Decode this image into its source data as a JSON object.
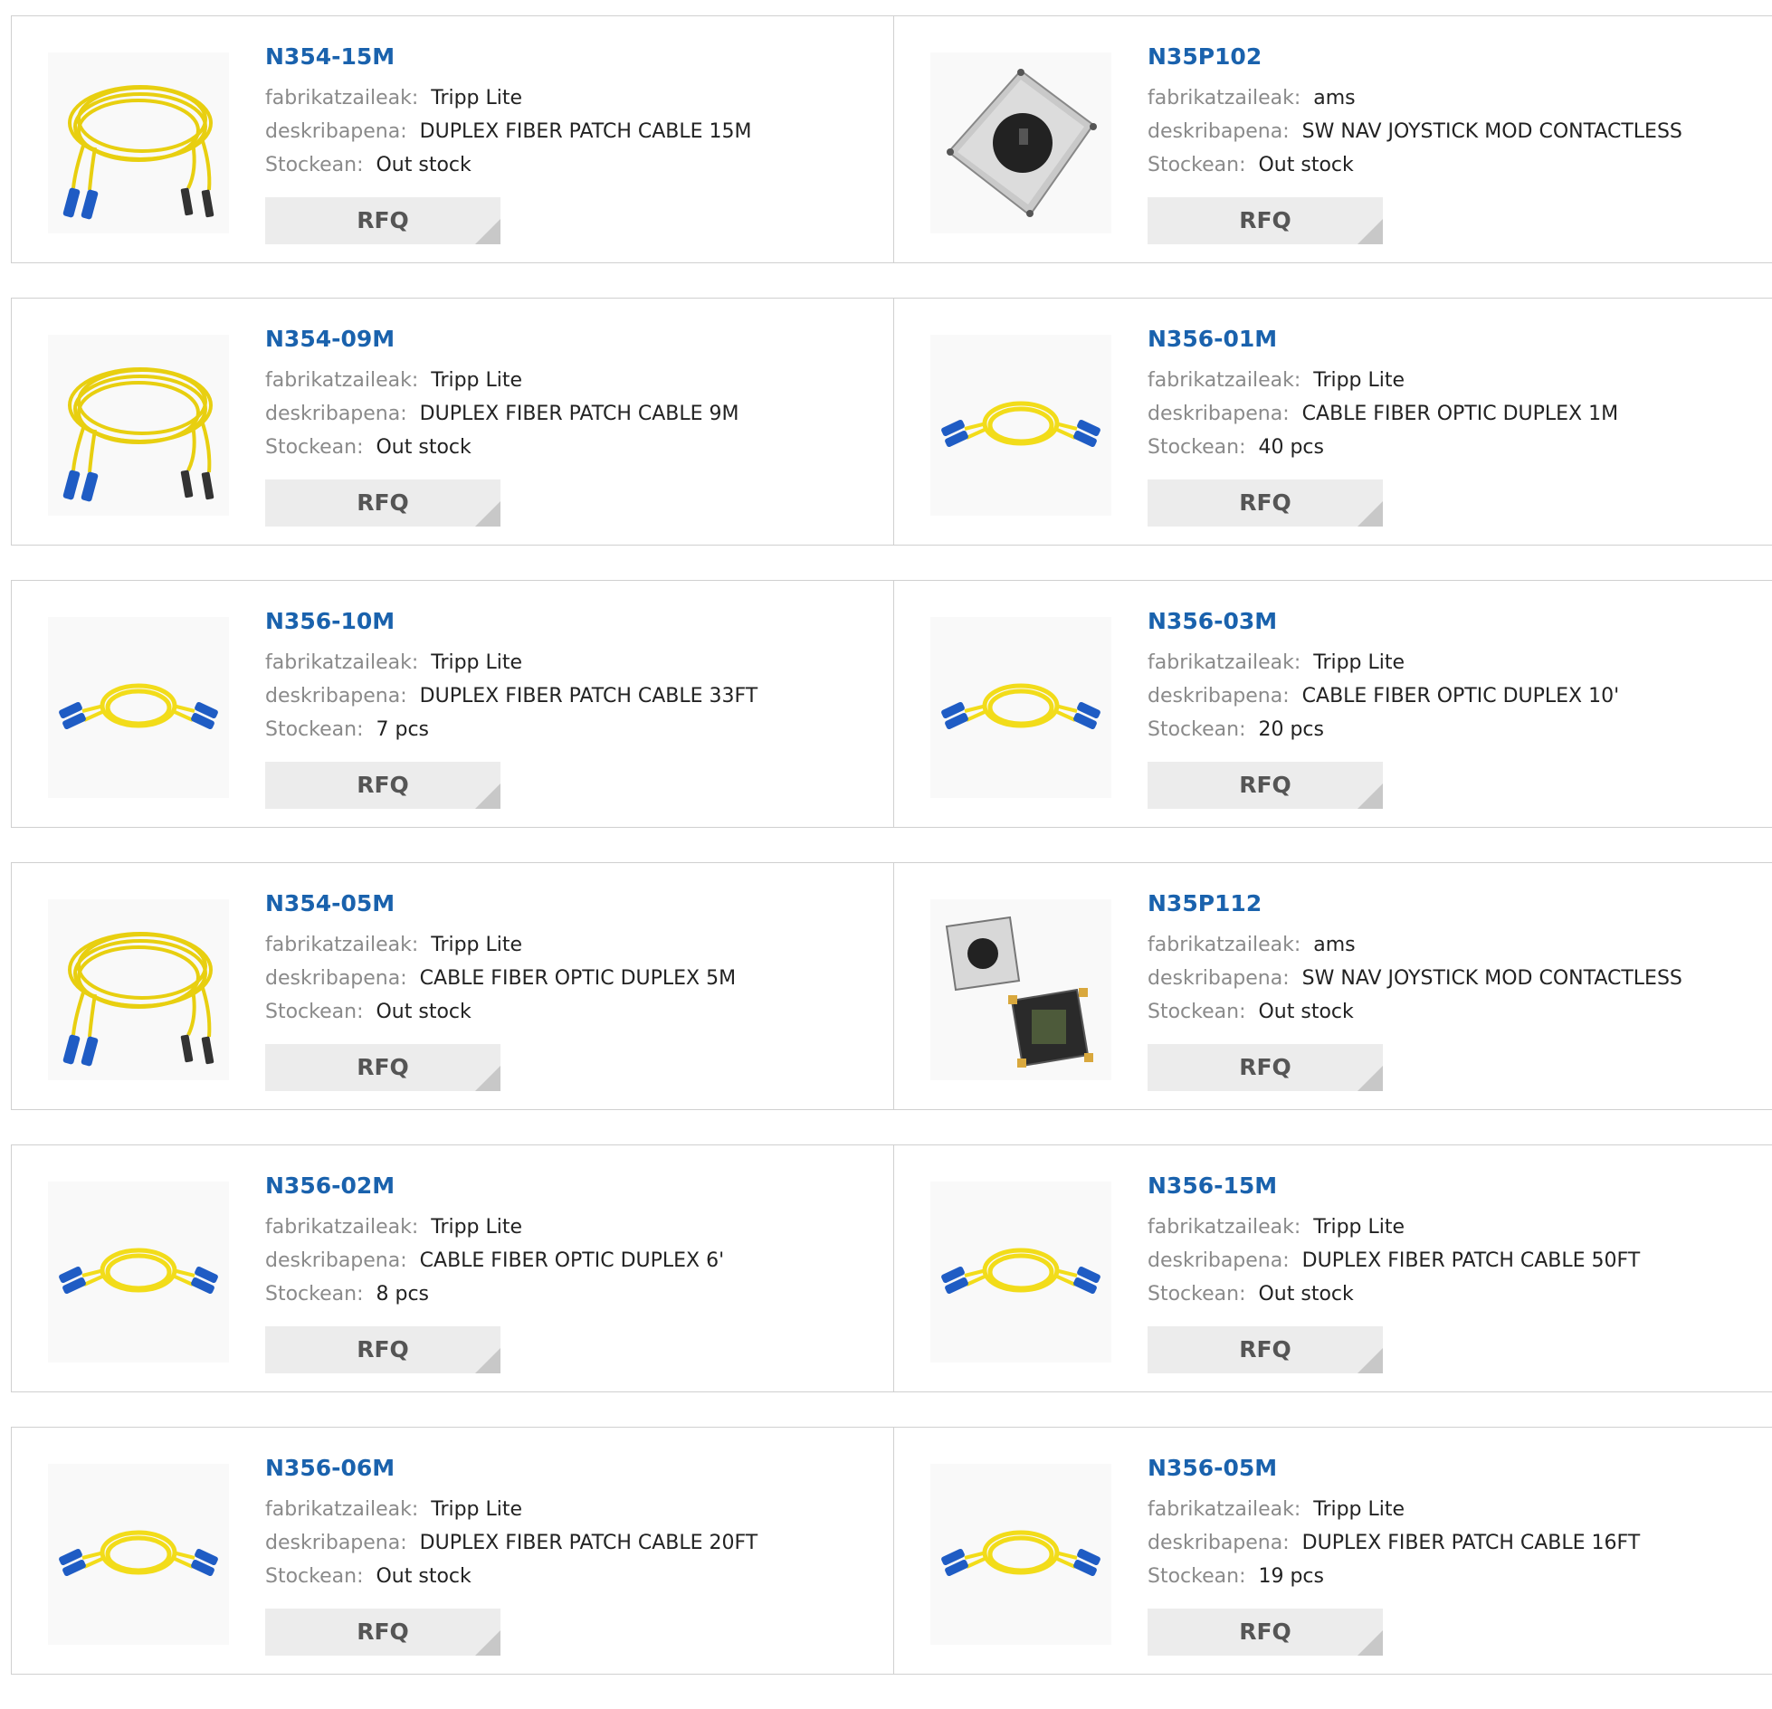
{
  "labels": {
    "manufacturer": "fabrikatzaileak:",
    "description": "deskribapena:",
    "stock": "Stockean:",
    "rfq": "RFQ"
  },
  "colors": {
    "part_link": "#1a62ad",
    "cable_yellow": "#f2dc1a",
    "connector_blue": "#1f5cc4"
  },
  "products": [
    {
      "part": "N354-15M",
      "manufacturer": "Tripp Lite",
      "description": "DUPLEX FIBER PATCH CABLE 15M",
      "stock": "Out stock",
      "image": "fiber-coil-st-cable"
    },
    {
      "part": "N35P102",
      "manufacturer": "ams",
      "description": "SW NAV JOYSTICK MOD CONTACTLESS",
      "stock": "Out stock",
      "image": "joystick-module"
    },
    {
      "part": "N354-09M",
      "manufacturer": "Tripp Lite",
      "description": "DUPLEX FIBER PATCH CABLE 9M",
      "stock": "Out stock",
      "image": "fiber-coil-st-cable"
    },
    {
      "part": "N356-01M",
      "manufacturer": "Tripp Lite",
      "description": "CABLE FIBER OPTIC DUPLEX 1M",
      "stock": "40 pcs",
      "image": "fiber-loop-sc-cable"
    },
    {
      "part": "N356-10M",
      "manufacturer": "Tripp Lite",
      "description": "DUPLEX FIBER PATCH CABLE 33FT",
      "stock": "7 pcs",
      "image": "fiber-loop-sc-cable"
    },
    {
      "part": "N356-03M",
      "manufacturer": "Tripp Lite",
      "description": "CABLE FIBER OPTIC DUPLEX 10'",
      "stock": "20 pcs",
      "image": "fiber-loop-sc-cable"
    },
    {
      "part": "N354-05M",
      "manufacturer": "Tripp Lite",
      "description": "CABLE FIBER OPTIC DUPLEX 5M",
      "stock": "Out stock",
      "image": "fiber-coil-st-cable"
    },
    {
      "part": "N35P112",
      "manufacturer": "ams",
      "description": "SW NAV JOYSTICK MOD CONTACTLESS",
      "stock": "Out stock",
      "image": "joystick-module-pair"
    },
    {
      "part": "N356-02M",
      "manufacturer": "Tripp Lite",
      "description": "CABLE FIBER OPTIC DUPLEX 6'",
      "stock": "8 pcs",
      "image": "fiber-loop-sc-cable"
    },
    {
      "part": "N356-15M",
      "manufacturer": "Tripp Lite",
      "description": "DUPLEX FIBER PATCH CABLE 50FT",
      "stock": "Out stock",
      "image": "fiber-loop-sc-cable"
    },
    {
      "part": "N356-06M",
      "manufacturer": "Tripp Lite",
      "description": "DUPLEX FIBER PATCH CABLE 20FT",
      "stock": "Out stock",
      "image": "fiber-loop-sc-cable"
    },
    {
      "part": "N356-05M",
      "manufacturer": "Tripp Lite",
      "description": "DUPLEX FIBER PATCH CABLE 16FT",
      "stock": "19 pcs",
      "image": "fiber-loop-sc-cable"
    }
  ]
}
